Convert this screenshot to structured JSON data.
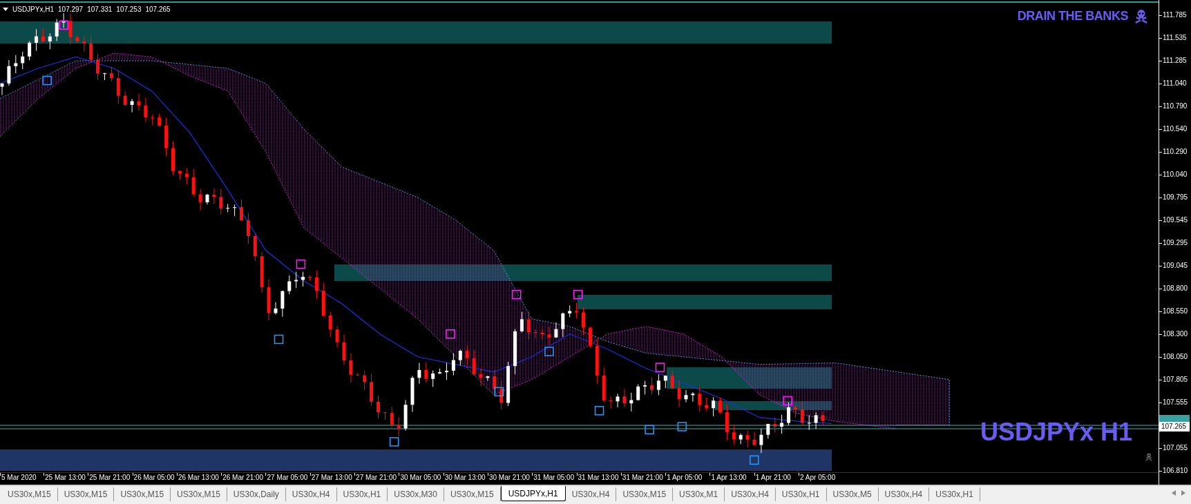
{
  "chart": {
    "symbol": "USDJPYx,H1",
    "quotes": [
      "107.297",
      "107.331",
      "107.253",
      "107.265"
    ],
    "banner": "DRAIN THE BANKS",
    "big_label": "USDJPYx H1",
    "current_price": "107.265",
    "price_axis": [
      "111.785",
      "111.535",
      "111.285",
      "111.040",
      "110.790",
      "110.540",
      "110.290",
      "110.040",
      "109.795",
      "109.545",
      "109.295",
      "109.045",
      "108.800",
      "108.550",
      "108.300",
      "108.050",
      "107.805",
      "107.555",
      "107.055",
      "106.810"
    ],
    "time_axis": [
      "5 Mar 2020",
      "25 Mar 13:00",
      "25 Mar 21:00",
      "26 Mar 05:00",
      "26 Mar 13:00",
      "26 Mar 21:00",
      "27 Mar 05:00",
      "27 Mar 13:00",
      "27 Mar 21:00",
      "30 Mar 05:00",
      "30 Mar 13:00",
      "30 Mar 21:00",
      "31 Mar 05:00",
      "31 Mar 13:00",
      "31 Mar 21:00",
      "1 Apr 05:00",
      "1 Apr 13:00",
      "1 Apr 21:00",
      "2 Apr 05:00"
    ]
  },
  "tabs": [
    {
      "label": "US30x,M15",
      "selected": false
    },
    {
      "label": "US30x,M15",
      "selected": false
    },
    {
      "label": "US30x,M15",
      "selected": false
    },
    {
      "label": "US30x,M15",
      "selected": false
    },
    {
      "label": "US30x,Daily",
      "selected": false
    },
    {
      "label": "US30x,H4",
      "selected": false
    },
    {
      "label": "US30x,H1",
      "selected": false
    },
    {
      "label": "US30x,M30",
      "selected": false
    },
    {
      "label": "US30x,M15",
      "selected": false
    },
    {
      "label": "USDJPYx,H1",
      "selected": true
    },
    {
      "label": "US30x,H4",
      "selected": false
    },
    {
      "label": "US30x,M15",
      "selected": false
    },
    {
      "label": "US30x,M1",
      "selected": false
    },
    {
      "label": "US30x,H4",
      "selected": false
    },
    {
      "label": "US30x,H1",
      "selected": false
    },
    {
      "label": "US30x,M5",
      "selected": false
    },
    {
      "label": "US30x,H4",
      "selected": false
    },
    {
      "label": "US30x,H1",
      "selected": false
    }
  ]
}
